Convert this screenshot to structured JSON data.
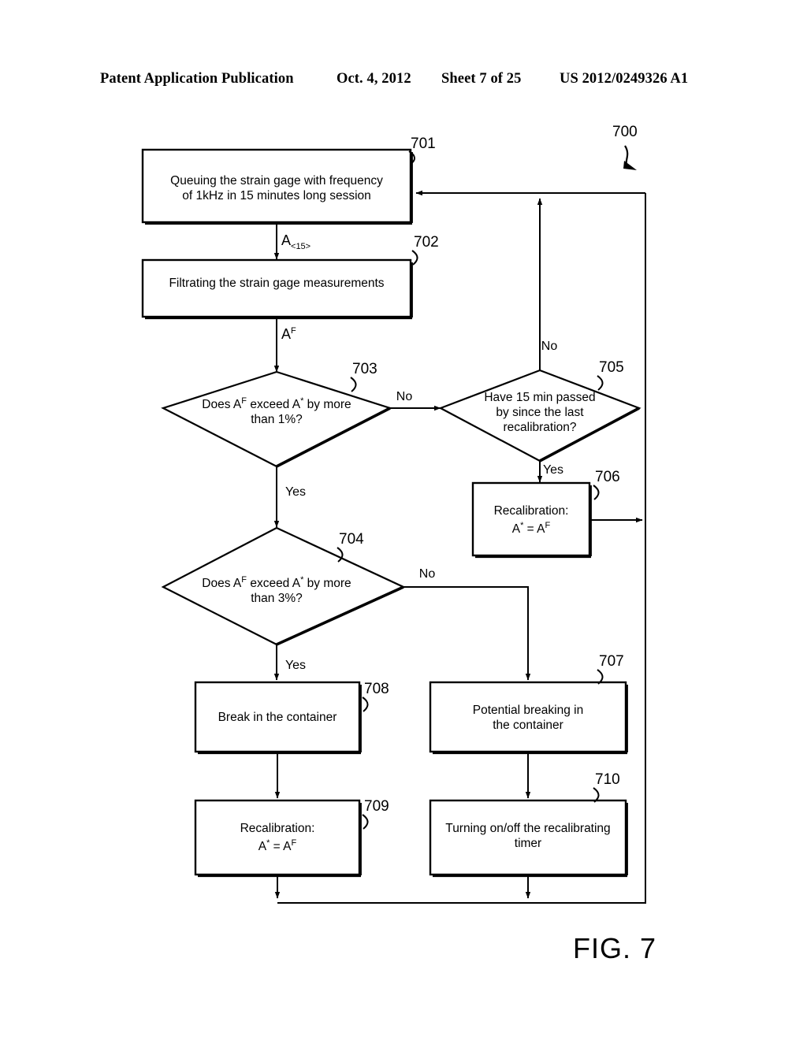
{
  "header": {
    "publication": "Patent Application Publication",
    "date": "Oct. 4, 2012",
    "sheet": "Sheet 7 of 25",
    "patent_number": "US 2012/0249326 A1"
  },
  "figure": {
    "caption": "FIG. 7",
    "diagram_ref": "700"
  },
  "flowchart": {
    "type": "flowchart",
    "nodes": [
      {
        "ref": "701",
        "shape": "process",
        "lines": [
          "Queuing the strain gage with frequency",
          "of 1kHz in 15 minutes long session"
        ]
      },
      {
        "ref": "702",
        "shape": "process",
        "lines": [
          "Filtrating the strain gage measurements"
        ]
      },
      {
        "ref": "703",
        "shape": "decision",
        "lines": [
          "Does A F exceed A * by more",
          "than 1%?"
        ],
        "line1_pre": "Does A",
        "line1_sup1": "F",
        "line1_mid": " exceed A",
        "line1_sup2": "*",
        "line1_post": " by more",
        "line2": "than 1%?"
      },
      {
        "ref": "704",
        "shape": "decision",
        "line1_pre": "Does A",
        "line1_sup1": "F",
        "line1_mid": " exceed A",
        "line1_sup2": "*",
        "line1_post": " by more",
        "line2": "than 3%?"
      },
      {
        "ref": "705",
        "shape": "decision",
        "lines": [
          "Have 15 min passed",
          "by since the last",
          "recalibration?"
        ]
      },
      {
        "ref": "706",
        "shape": "process",
        "title": "Recalibration:",
        "formula_a": "A",
        "formula_a_sup": "*",
        "formula_eq": " = A",
        "formula_b_sup": "F"
      },
      {
        "ref": "707",
        "shape": "process",
        "lines": [
          "Potential breaking in",
          "the container"
        ]
      },
      {
        "ref": "708",
        "shape": "process",
        "lines": [
          "Break in the container"
        ]
      },
      {
        "ref": "709",
        "shape": "process",
        "title": "Recalibration:",
        "formula_a": "A",
        "formula_a_sup": "*",
        "formula_eq": " = A",
        "formula_b_sup": "F"
      },
      {
        "ref": "710",
        "shape": "process",
        "lines": [
          "Turning on/off the recalibrating",
          "timer"
        ]
      }
    ],
    "edge_labels": {
      "a15_base": "A",
      "a15_sub": "<15>",
      "af_base": "A",
      "af_sup": "F",
      "no_703_705": "No",
      "no_705_top": "No",
      "yes_703_704": "Yes",
      "yes_705_706": "Yes",
      "no_704_707": "No",
      "yes_704_708": "Yes"
    }
  }
}
